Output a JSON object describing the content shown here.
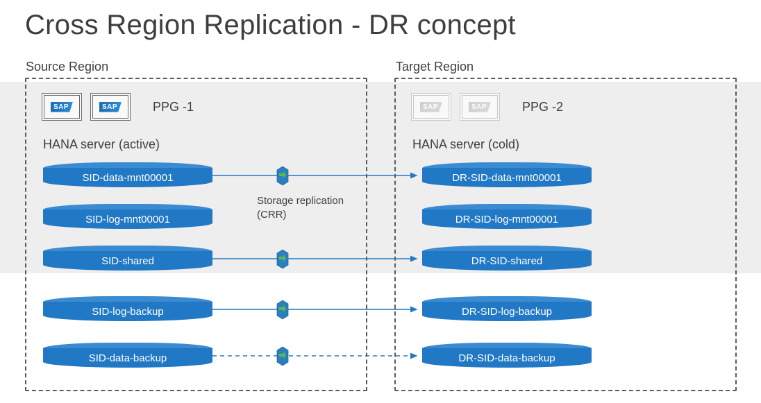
{
  "title": "Cross Region Replication - DR concept",
  "source": {
    "label": "Source Region",
    "ppg": "PPG -1",
    "server": "HANA server (active)",
    "sap_logo": "SAP",
    "disks": {
      "data": "SID-data-mnt00001",
      "log": "SID-log-mnt00001",
      "shared": "SID-shared",
      "logbk": "SID-log-backup",
      "databk": "SID-data-backup"
    }
  },
  "target": {
    "label": "Target Region",
    "ppg": "PPG -2",
    "server": "HANA server (cold)",
    "sap_logo": "SAP",
    "disks": {
      "data": "DR-SID-data-mnt00001",
      "log": "DR-SID-log-mnt00001",
      "shared": "DR-SID-shared",
      "logbk": "DR-SID-log-backup",
      "databk": "DR-SID-data-backup"
    }
  },
  "replication_label": "Storage replication (CRR)"
}
